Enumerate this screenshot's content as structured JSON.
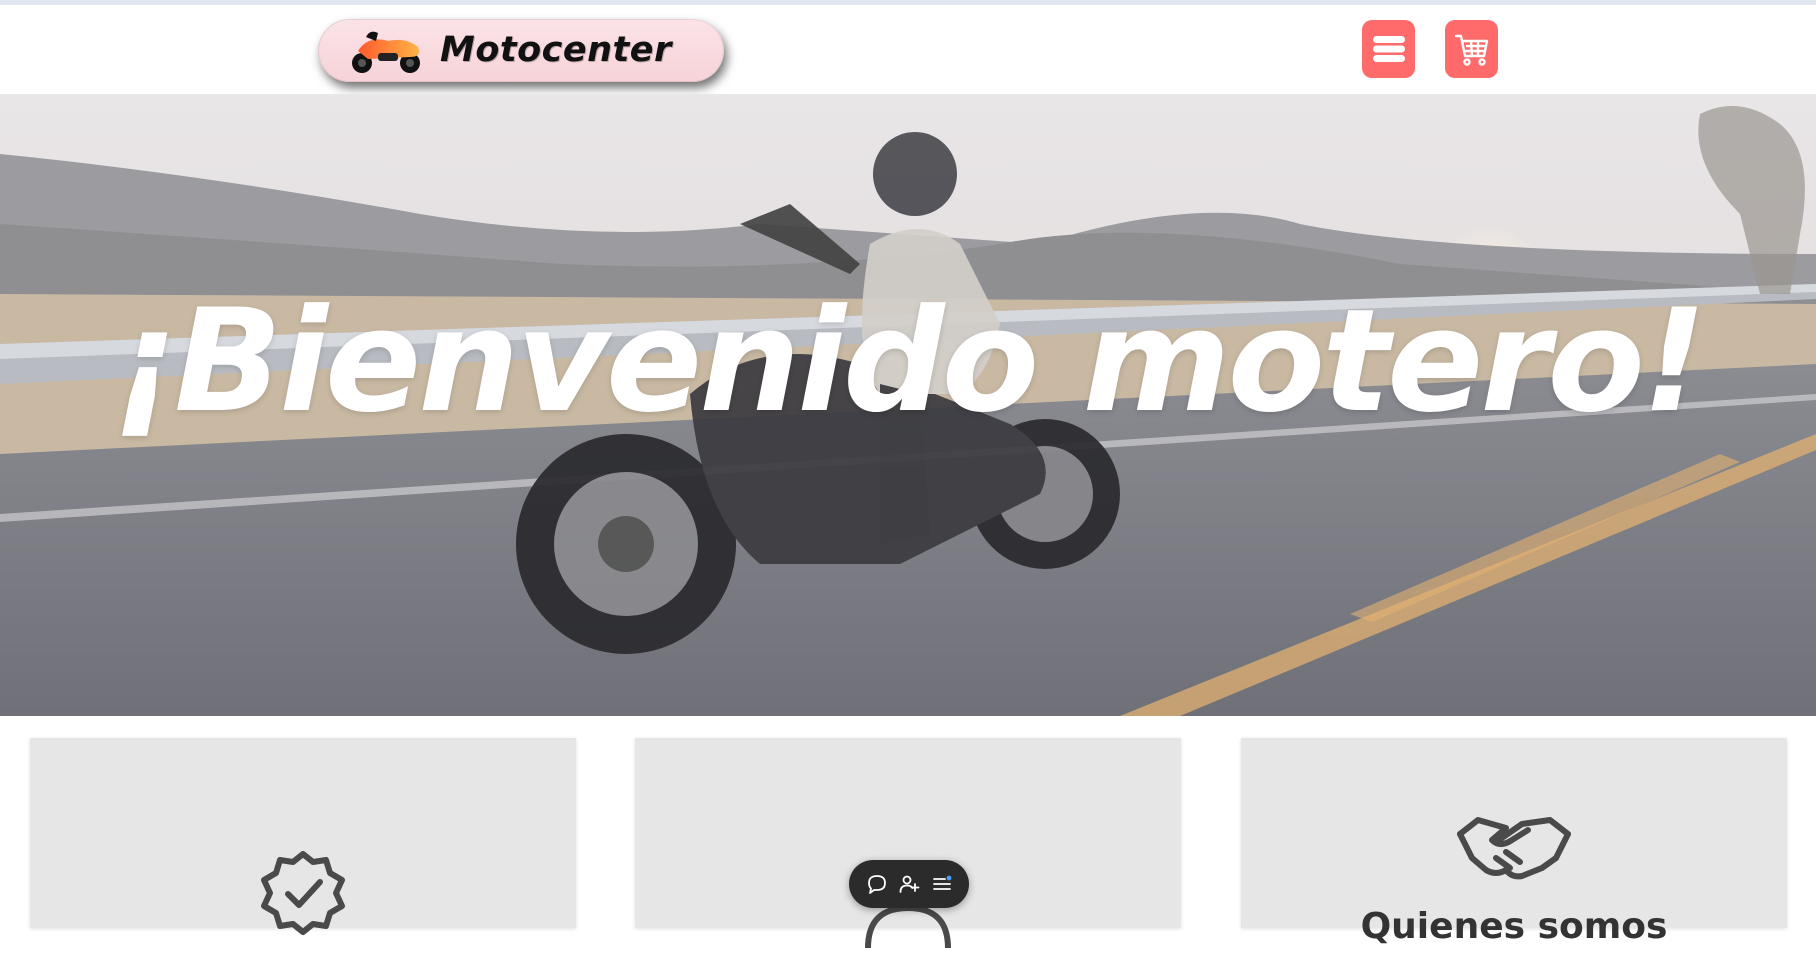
{
  "header": {
    "logo_text": "Motocenter",
    "menu_button_icon": "hamburger-menu-icon",
    "cart_button_icon": "shopping-cart-icon"
  },
  "hero": {
    "title": "¡Bienvenido motero!"
  },
  "cards": [
    {
      "icon": "verified-badge-icon",
      "title": ""
    },
    {
      "icon": "support-icon",
      "title": ""
    },
    {
      "icon": "handshake-icon",
      "title": "Quienes somos"
    }
  ],
  "floating_toolbar": {
    "items": [
      "chat-icon",
      "add-user-icon",
      "list-icon"
    ]
  },
  "colors": {
    "accent": "#ff6a6a",
    "logo_pill": "#f8d9de",
    "card_bg": "#e6e6e6",
    "toolbar_bg": "#2b2b2b"
  }
}
